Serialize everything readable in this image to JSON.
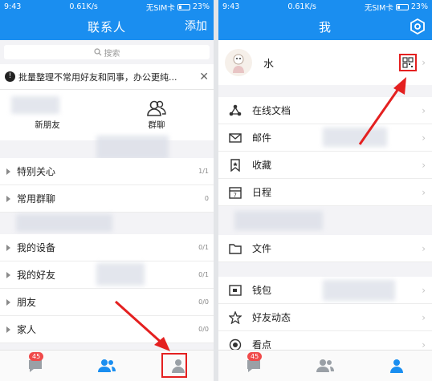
{
  "status": {
    "time": "9:43",
    "speed": "0.61K/s",
    "sim": "无SIM卡",
    "battery": "23%"
  },
  "left": {
    "title": "联系人",
    "action": "添加",
    "search_placeholder": "搜索",
    "notice": "批量整理不常用好友和同事，办公更纯...",
    "quick": [
      {
        "label": "新朋友"
      },
      {
        "label": "群聊"
      }
    ],
    "groups": [
      {
        "label": "特别关心",
        "count": "1/1"
      },
      {
        "label": "常用群聊",
        "count": "0"
      },
      {
        "label": "我的设备",
        "count": "0/1"
      },
      {
        "label": "我的好友",
        "count": "0/1"
      },
      {
        "label": "朋友",
        "count": "0/0"
      },
      {
        "label": "家人",
        "count": "0/0"
      }
    ],
    "tab_badge": "45"
  },
  "right": {
    "title": "我",
    "name": "水",
    "menu_a": [
      {
        "label": "在线文档",
        "icon": "online-doc-icon"
      },
      {
        "label": "邮件",
        "icon": "mail-icon"
      },
      {
        "label": "收藏",
        "icon": "bookmark-icon"
      },
      {
        "label": "日程",
        "icon": "calendar-icon"
      }
    ],
    "menu_b": [
      {
        "label": "文件",
        "icon": "folder-icon"
      }
    ],
    "menu_c": [
      {
        "label": "钱包",
        "icon": "wallet-icon"
      },
      {
        "label": "好友动态",
        "icon": "star-icon"
      },
      {
        "label": "看点",
        "icon": "eye-icon"
      }
    ],
    "tab_badge": "45"
  },
  "colors": {
    "primary": "#1a8ef0",
    "highlight": "#e42020",
    "badge": "#f04a4a"
  }
}
